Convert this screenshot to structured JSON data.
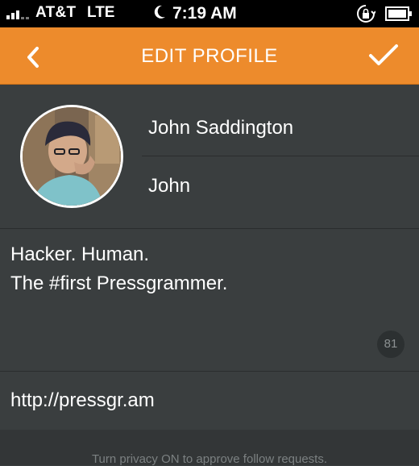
{
  "status_bar": {
    "carrier": "AT&T",
    "network": "LTE",
    "time": "7:19 AM",
    "icons": [
      "signal-icon",
      "moon-icon",
      "rotation-lock-icon",
      "battery-icon"
    ]
  },
  "nav": {
    "title": "EDIT PROFILE",
    "back_icon": "chevron-left-icon",
    "done_icon": "checkmark-icon"
  },
  "profile": {
    "full_name": "John Saddington",
    "username": "John",
    "avatar": "profile-photo"
  },
  "bio": {
    "line1": "Hacker. Human.",
    "line2": "The #first Pressgrammer.",
    "remaining_chars": "81"
  },
  "website": {
    "url": "http://pressgr.am"
  },
  "privacy": {
    "hint": "Turn privacy ON to approve follow requests."
  },
  "colors": {
    "accent": "#ed8b2c",
    "background": "#3a3e3f"
  }
}
